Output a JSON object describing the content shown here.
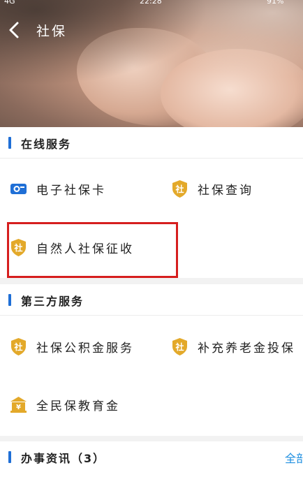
{
  "status_bar": {
    "network": "4G",
    "time": "22:28",
    "battery": "91%"
  },
  "header": {
    "title": "社保",
    "back_icon": "chevron-left-icon"
  },
  "sections": {
    "online": {
      "title": "在线服务",
      "items": [
        {
          "label": "电子社保卡",
          "icon": "id-card-icon"
        },
        {
          "label": "社保查询",
          "icon": "shebao-shield-icon"
        },
        {
          "label": "自然人社保征收",
          "icon": "shebao-shield-icon"
        }
      ]
    },
    "third": {
      "title": "第三方服务",
      "items": [
        {
          "label": "社保公积金服务",
          "icon": "shebao-shield-icon"
        },
        {
          "label": "补充养老金投保",
          "icon": "shebao-shield-icon"
        },
        {
          "label": "全民保教育金",
          "icon": "bank-icon"
        }
      ]
    },
    "news": {
      "title": "办事资讯（3）",
      "more": "全部"
    }
  },
  "badge_char": "社",
  "colors": {
    "accent_blue": "#1f6fd6",
    "badge_gold": "#e3a92a",
    "highlight_red": "#d61e1e",
    "link_blue": "#1f8fe0"
  }
}
